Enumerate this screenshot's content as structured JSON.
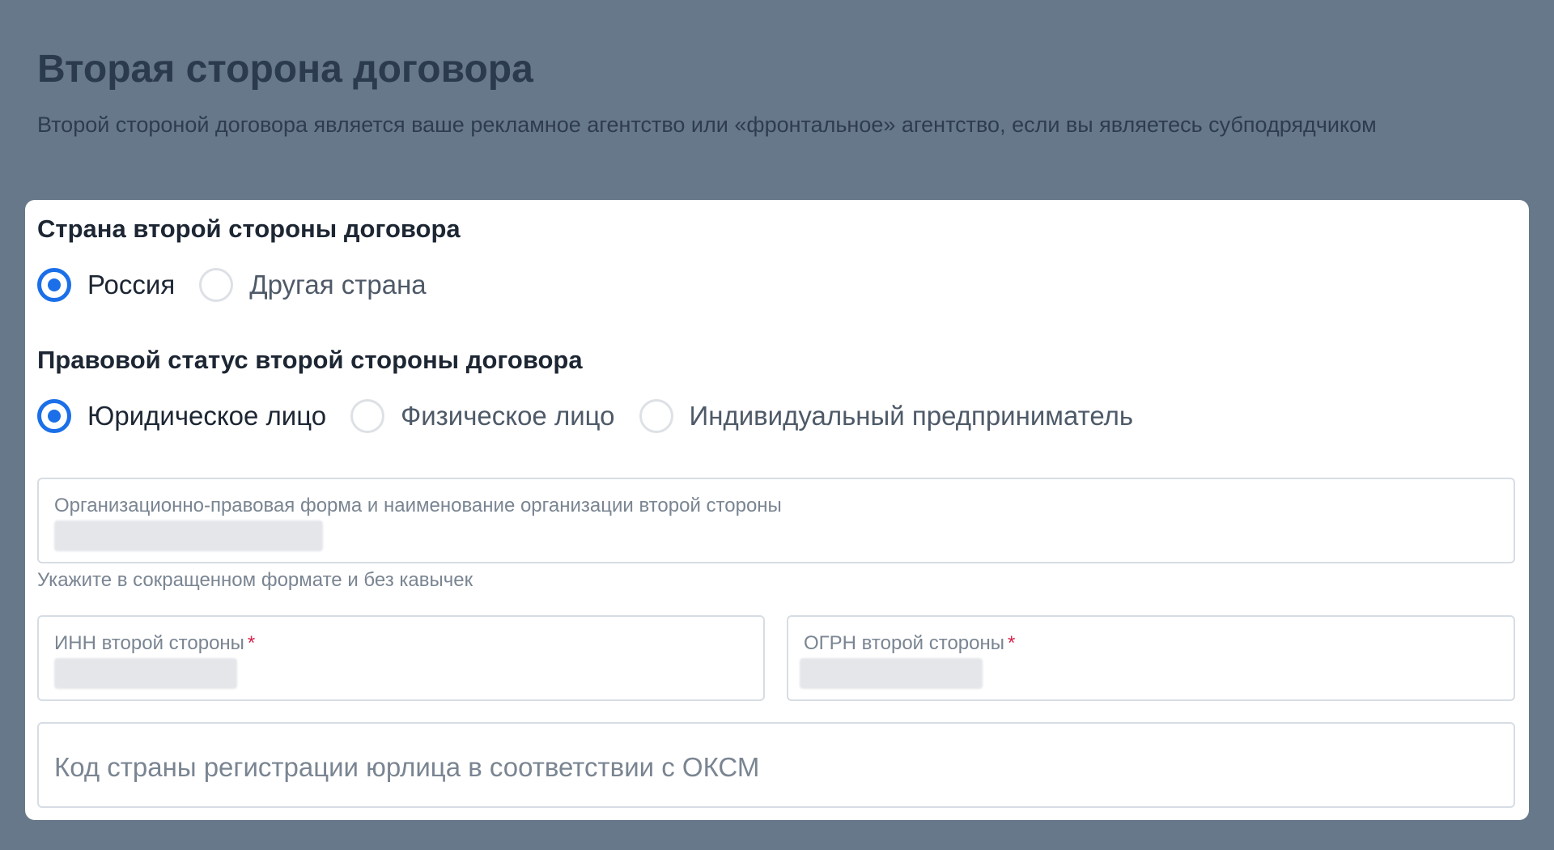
{
  "header": {
    "title": "Вторая сторона договора",
    "subtitle": "Второй стороной договора является ваше рекламное агентство или «фронтальное» агентство, если вы являетесь субподрядчиком"
  },
  "country_section": {
    "title": "Страна второй стороны договора",
    "options": [
      {
        "label": "Россия",
        "checked": true
      },
      {
        "label": "Другая страна",
        "checked": false
      }
    ]
  },
  "status_section": {
    "title": "Правовой статус второй стороны договора",
    "options": [
      {
        "label": "Юридическое лицо",
        "checked": true
      },
      {
        "label": "Физическое лицо",
        "checked": false
      },
      {
        "label": "Индивидуальный предприниматель",
        "checked": false
      }
    ]
  },
  "fields": {
    "org_name": {
      "label": "Организационно-правовая форма и наименование организации второй стороны",
      "value": "",
      "hint": "Укажите в сокращенном формате и без кавычек"
    },
    "inn": {
      "label": "ИНН второй стороны",
      "required_mark": "*",
      "value": ""
    },
    "ogrn": {
      "label": "ОГРН второй стороны",
      "required_mark": "*",
      "value": ""
    },
    "oksm": {
      "placeholder": "Код страны регистрации юрлица в соответствии с ОКСМ",
      "value": ""
    }
  },
  "colors": {
    "background": "#67788a",
    "card": "#ffffff",
    "accent": "#1b6fe8",
    "required": "#d4234a",
    "field_border": "#d7dde4"
  }
}
